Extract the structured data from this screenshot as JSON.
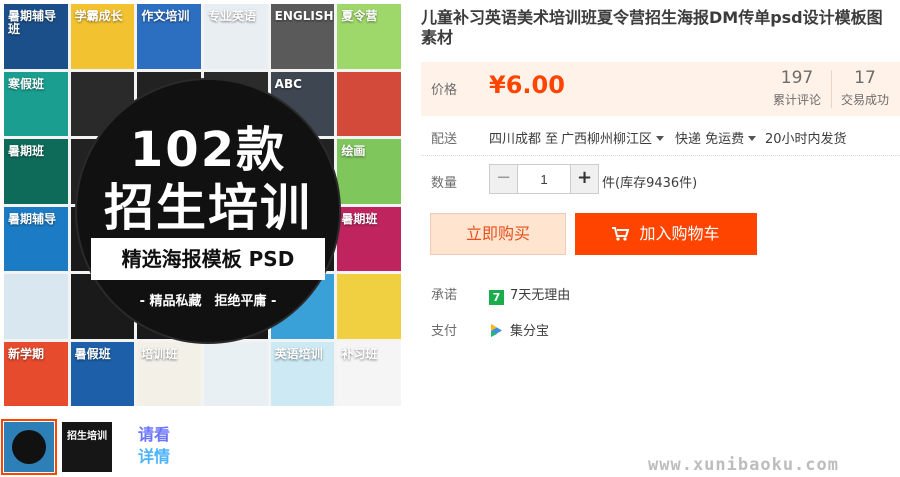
{
  "product": {
    "title": "儿童补习英语美术培训班夏令营招生海报DM传单psd设计模板图素材"
  },
  "gallery": {
    "cover_count": "102款",
    "cover_main": "招生培训",
    "cover_bar": "精选海报模板 PSD",
    "cover_sub": "- 精品私藏　拒绝平庸 -",
    "tiles": [
      {
        "text": "暑期辅导班",
        "color": "#1b4f8a"
      },
      {
        "text": "学霸成长",
        "color": "#f2c230"
      },
      {
        "text": "作文培训",
        "color": "#2c6fc0"
      },
      {
        "text": "专业英语",
        "color": "#e9eef2"
      },
      {
        "text": "ENGLISH",
        "color": "#5a5a5a"
      },
      {
        "text": "夏令营",
        "color": "#9fd86a"
      },
      {
        "text": "寒假班",
        "color": "#1a9e8f"
      },
      {
        "text": "",
        "color": "#2a2a2a"
      },
      {
        "text": "",
        "color": "#222222"
      },
      {
        "text": "",
        "color": "#2b2b2b"
      },
      {
        "text": "ABC",
        "color": "#3e4652"
      },
      {
        "text": "",
        "color": "#d44a3a"
      },
      {
        "text": "暑期班",
        "color": "#0e6b5a"
      },
      {
        "text": "",
        "color": "#222"
      },
      {
        "text": "",
        "color": "#222"
      },
      {
        "text": "",
        "color": "#222"
      },
      {
        "text": "",
        "color": "#222"
      },
      {
        "text": "绘画",
        "color": "#7fc65c"
      },
      {
        "text": "暑期辅导",
        "color": "#1b7bc4"
      },
      {
        "text": "",
        "color": "#1a1a1a"
      },
      {
        "text": "",
        "color": "#1a1a1a"
      },
      {
        "text": "",
        "color": "#1a1a1a"
      },
      {
        "text": "",
        "color": "#1a1a1a"
      },
      {
        "text": "暑期班",
        "color": "#c0245e"
      },
      {
        "text": "",
        "color": "#d9e8f0"
      },
      {
        "text": "",
        "color": "#1a1a1a"
      },
      {
        "text": "",
        "color": "#1a1a1a"
      },
      {
        "text": "",
        "color": "#1a1a1a"
      },
      {
        "text": "",
        "color": "#3aa0d8"
      },
      {
        "text": "",
        "color": "#f0d040"
      },
      {
        "text": "新学期",
        "color": "#e64b2e"
      },
      {
        "text": "暑假班",
        "color": "#1d5fa8"
      },
      {
        "text": "培训班",
        "color": "#f3f0e8"
      },
      {
        "text": "",
        "color": "#e8f0f4"
      },
      {
        "text": "英语培训",
        "color": "#cde9f3"
      },
      {
        "text": "补习班",
        "color": "#f5f5f5"
      }
    ],
    "thumb2_text": "招生培训",
    "see_detail": [
      "请看",
      "详情"
    ]
  },
  "price": {
    "label": "价格",
    "value": "¥6.00",
    "review_count": "197",
    "review_label": "累计评论",
    "deal_count": "17",
    "deal_label": "交易成功"
  },
  "shipping": {
    "label": "配送",
    "from": "四川成都 至",
    "to": "广西柳州柳江区",
    "method": "快递 免运费",
    "dispatch": "20小时内发货"
  },
  "quantity": {
    "label": "数量",
    "minus": "−",
    "value": "1",
    "plus": "+",
    "stock": "件(库存9436件)"
  },
  "actions": {
    "buy_now": "立即购买",
    "add_cart": "加入购物车"
  },
  "promise": {
    "label": "承诺",
    "icon_text": "7",
    "value": "7天无理由"
  },
  "payment": {
    "label": "支付",
    "value": "集分宝"
  },
  "watermark": "www.xunibaoku.com"
}
